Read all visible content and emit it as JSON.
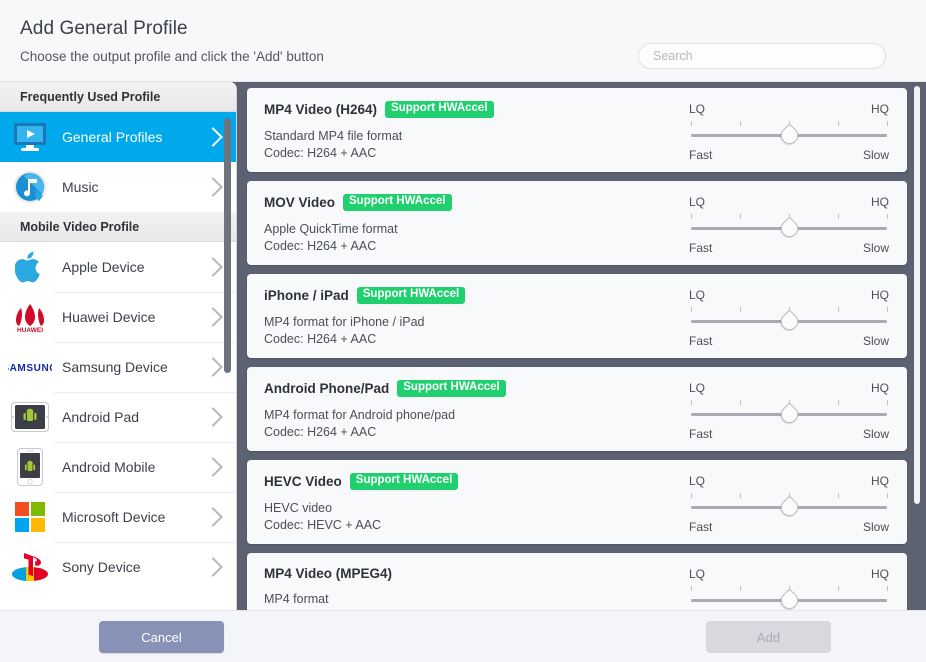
{
  "header": {
    "title": "Add General Profile",
    "subtitle": "Choose the output profile and click the 'Add' button",
    "search_placeholder": "Search",
    "search_value": ""
  },
  "sidebar": {
    "sections": [
      {
        "label": "Frequently Used Profile",
        "items": [
          {
            "label": "General Profiles",
            "icon": "monitor-play-icon",
            "active": true
          },
          {
            "label": "Music",
            "icon": "music-note-icon",
            "active": false
          }
        ]
      },
      {
        "label": "Mobile Video Profile",
        "items": [
          {
            "label": "Apple Device",
            "icon": "apple-logo-icon",
            "active": false
          },
          {
            "label": "Huawei Device",
            "icon": "huawei-logo-icon",
            "active": false
          },
          {
            "label": "Samsung Device",
            "icon": "samsung-logo-icon",
            "active": false
          },
          {
            "label": "Android Pad",
            "icon": "android-tablet-icon",
            "active": false
          },
          {
            "label": "Android Mobile",
            "icon": "android-phone-icon",
            "active": false
          },
          {
            "label": "Microsoft Device",
            "icon": "microsoft-logo-icon",
            "active": false
          },
          {
            "label": "Sony Device",
            "icon": "playstation-logo-icon",
            "active": false
          }
        ]
      }
    ]
  },
  "slider": {
    "left_top_label": "LQ",
    "right_top_label": "HQ",
    "left_bottom_label": "Fast",
    "right_bottom_label": "Slow",
    "tick_count": 5,
    "value_percent": 50
  },
  "profiles": [
    {
      "title": "MP4 Video (H264)",
      "badge": "Support HWAccel",
      "desc_line1": "Standard MP4 file format",
      "desc_line2": "Codec: H264 + AAC",
      "quality_percent": 50
    },
    {
      "title": "MOV Video",
      "badge": "Support HWAccel",
      "desc_line1": "Apple QuickTime format",
      "desc_line2": "Codec: H264 + AAC",
      "quality_percent": 50
    },
    {
      "title": "iPhone / iPad",
      "badge": "Support HWAccel",
      "desc_line1": "MP4 format for iPhone / iPad",
      "desc_line2": "Codec: H264 + AAC",
      "quality_percent": 50
    },
    {
      "title": "Android Phone/Pad",
      "badge": "Support HWAccel",
      "desc_line1": "MP4 format for Android phone/pad",
      "desc_line2": "Codec: H264 + AAC",
      "quality_percent": 50
    },
    {
      "title": "HEVC Video",
      "badge": "Support HWAccel",
      "desc_line1": "HEVC video",
      "desc_line2": "Codec: HEVC + AAC",
      "quality_percent": 50
    },
    {
      "title": "MP4 Video (MPEG4)",
      "badge": "",
      "desc_line1": "MP4 format",
      "desc_line2": "",
      "quality_percent": 50
    }
  ],
  "footer": {
    "cancel_label": "Cancel",
    "add_label": "Add",
    "add_disabled": true
  },
  "colors": {
    "accent_blue": "#00a8ec",
    "badge_green": "#20d06f",
    "panel_slate": "#5d6273",
    "cancel_button": "#8792b6"
  }
}
